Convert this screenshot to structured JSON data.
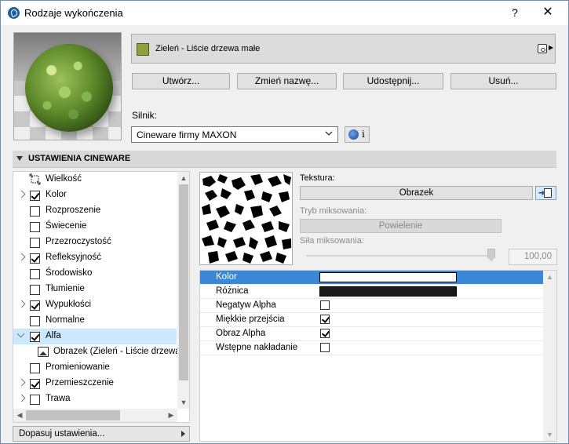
{
  "window": {
    "title": "Rodzaje wykończenia",
    "help_label": "?",
    "close_label": "✕"
  },
  "material": {
    "name": "Zieleń - Liście drzewa małe",
    "swatch_color": "#8da23a"
  },
  "buttons": {
    "create": "Utwórz...",
    "rename": "Zmień nazwę...",
    "share": "Udostępnij...",
    "delete": "Usuń..."
  },
  "engine": {
    "label": "Silnik:",
    "value": "Cineware firmy MAXON",
    "info_label": "i"
  },
  "section": {
    "title": "USTAWIENIA CINEWARE"
  },
  "tree": {
    "items": [
      {
        "label": "Wielkość",
        "expander": "none",
        "checkbox": "none",
        "icon": "size-icon"
      },
      {
        "label": "Kolor",
        "expander": "collapsed",
        "checkbox": "checked"
      },
      {
        "label": "Rozproszenie",
        "expander": "none",
        "checkbox": "unchecked"
      },
      {
        "label": "Świecenie",
        "expander": "none",
        "checkbox": "unchecked"
      },
      {
        "label": "Przezroczystość",
        "expander": "none",
        "checkbox": "unchecked"
      },
      {
        "label": "Refleksyjność",
        "expander": "collapsed",
        "checkbox": "checked"
      },
      {
        "label": "Środowisko",
        "expander": "none",
        "checkbox": "unchecked"
      },
      {
        "label": "Tłumienie",
        "expander": "none",
        "checkbox": "unchecked"
      },
      {
        "label": "Wypukłości",
        "expander": "collapsed",
        "checkbox": "checked"
      },
      {
        "label": "Normalne",
        "expander": "none",
        "checkbox": "unchecked"
      },
      {
        "label": "Alfa",
        "expander": "expanded",
        "checkbox": "checked",
        "selected": true
      },
      {
        "label": "Obrazek (Zieleń - Liście drzewa",
        "expander": "none",
        "checkbox": "none",
        "icon": "image-icon",
        "child": true
      },
      {
        "label": "Promieniowanie",
        "expander": "none",
        "checkbox": "unchecked"
      },
      {
        "label": "Przemieszczenie",
        "expander": "collapsed",
        "checkbox": "checked"
      },
      {
        "label": "Trawa",
        "expander": "collapsed",
        "checkbox": "unchecked"
      }
    ]
  },
  "adjust": {
    "label": "Dopasuj ustawienia..."
  },
  "texture": {
    "label": "Tekstura:",
    "button": "Obrazek",
    "mix_mode_label": "Tryb miksowania:",
    "mix_mode_value": "Powielenie",
    "mix_strength_label": "Siła miksowania:",
    "mix_strength_value": "100,00",
    "mix_strength_fraction": 1.0
  },
  "properties": {
    "rows": [
      {
        "label": "Kolor",
        "type": "color",
        "value_color": "#ffffff",
        "selected": true
      },
      {
        "label": "Różnica",
        "type": "color",
        "value_color": "#1a1a1a"
      },
      {
        "label": "Negatyw Alpha",
        "type": "checkbox",
        "checked": false
      },
      {
        "label": "Miękkie przejścia",
        "type": "checkbox",
        "checked": true
      },
      {
        "label": "Obraz Alpha",
        "type": "checkbox",
        "checked": true
      },
      {
        "label": "Wstępne nakładanie",
        "type": "checkbox",
        "checked": false
      }
    ]
  }
}
